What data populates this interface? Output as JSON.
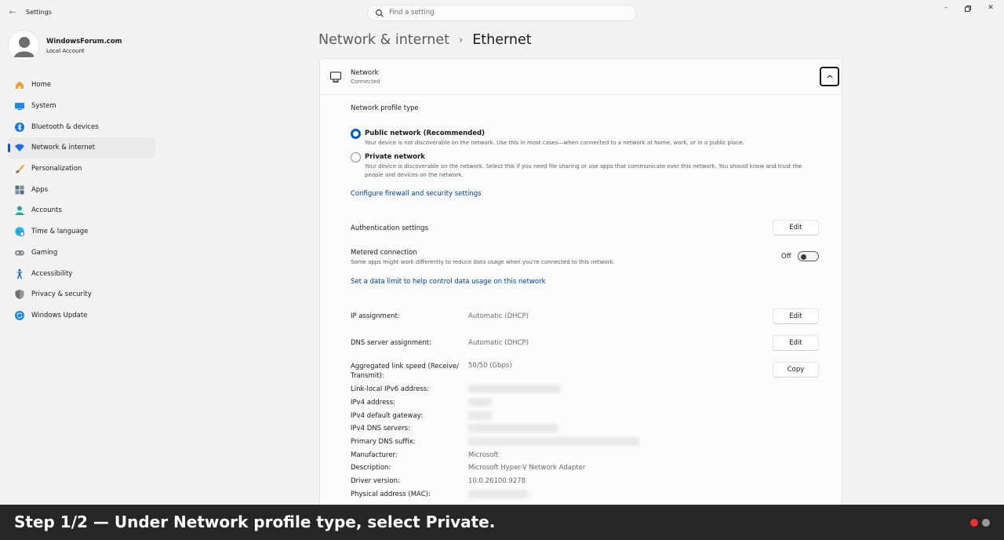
{
  "app": {
    "title": "Settings",
    "back_icon": "back-arrow-icon"
  },
  "search": {
    "placeholder": "Find a setting"
  },
  "window_controls": [
    "minimize",
    "restore",
    "close"
  ],
  "account": {
    "name": "WindowsForum.com",
    "type": "Local Account"
  },
  "sidebar": {
    "items": [
      {
        "label": "Home",
        "icon": "home-icon"
      },
      {
        "label": "System",
        "icon": "system-icon"
      },
      {
        "label": "Bluetooth & devices",
        "icon": "bluetooth-icon"
      },
      {
        "label": "Network & internet",
        "icon": "wifi-icon",
        "active": true
      },
      {
        "label": "Personalization",
        "icon": "brush-icon"
      },
      {
        "label": "Apps",
        "icon": "apps-icon"
      },
      {
        "label": "Accounts",
        "icon": "accounts-icon"
      },
      {
        "label": "Time & language",
        "icon": "globe-icon"
      },
      {
        "label": "Gaming",
        "icon": "gamepad-icon"
      },
      {
        "label": "Accessibility",
        "icon": "accessibility-icon"
      },
      {
        "label": "Privacy & security",
        "icon": "shield-icon"
      },
      {
        "label": "Windows Update",
        "icon": "update-icon"
      }
    ]
  },
  "header": {
    "parent": "Network & internet",
    "separator": "›",
    "current": "Ethernet"
  },
  "network": {
    "title": "Network",
    "status": "Connected",
    "profile_type_label": "Network profile type",
    "public": {
      "label": "Public network (Recommended)",
      "desc": "Your device is not discoverable on the network. Use this in most cases—when connected to a network at home, work, or in a public place.",
      "selected": true
    },
    "private": {
      "label": "Private network",
      "desc_line1": "Your device is discoverable on the network. Select this if you need file sharing or use apps that communicate over this network. You should know and trust the",
      "desc_line2": "people and devices on the network.",
      "selected": false
    },
    "firewall_link": "Configure firewall and security settings",
    "auth_label": "Authentication settings",
    "edit_label": "Edit",
    "metered": {
      "label": "Metered connection",
      "desc": "Some apps might work differently to reduce data usage when you're connected to this network",
      "state": "Off"
    },
    "data_limit_link": "Set a data limit to help control data usage on this network",
    "ip_assignment": {
      "label": "IP assignment:",
      "value": "Automatic (DHCP)"
    },
    "dns_assignment": {
      "label": "DNS server assignment:",
      "value": "Automatic (DHCP)"
    },
    "link_speed": {
      "label_line1": "Aggregated link speed (Receive/",
      "label_line2": "Transmit):",
      "value": "50/50 (Gbps)"
    },
    "copy_label": "Copy",
    "properties": [
      {
        "label": "Link-local IPv6 address:",
        "value": "",
        "redacted": true
      },
      {
        "label": "IPv4 address:",
        "value": "",
        "redacted": true
      },
      {
        "label": "IPv4 default gateway:",
        "value": "",
        "redacted": true
      },
      {
        "label": "IPv4 DNS servers:",
        "value": "",
        "redacted": true
      },
      {
        "label": "Primary DNS suffix:",
        "value": "",
        "redacted": true
      },
      {
        "label": "Manufacturer:",
        "value": "Microsoft",
        "redacted": false
      },
      {
        "label": "Description:",
        "value": "Microsoft Hyper-V Network Adapter",
        "redacted": false
      },
      {
        "label": "Driver version:",
        "value": "10.0.26100.9278",
        "redacted": false
      },
      {
        "label": "Physical address (MAC):",
        "value": "",
        "redacted": true
      }
    ]
  },
  "banner": {
    "text": "Step 1/2 — Under Network profile type, select Private."
  },
  "colors": {
    "accent": "#005fb8",
    "link": "#003e92",
    "banner_bg": "#262626",
    "dot_active": "#e8322b",
    "dot_inactive": "#9a9a9a"
  }
}
